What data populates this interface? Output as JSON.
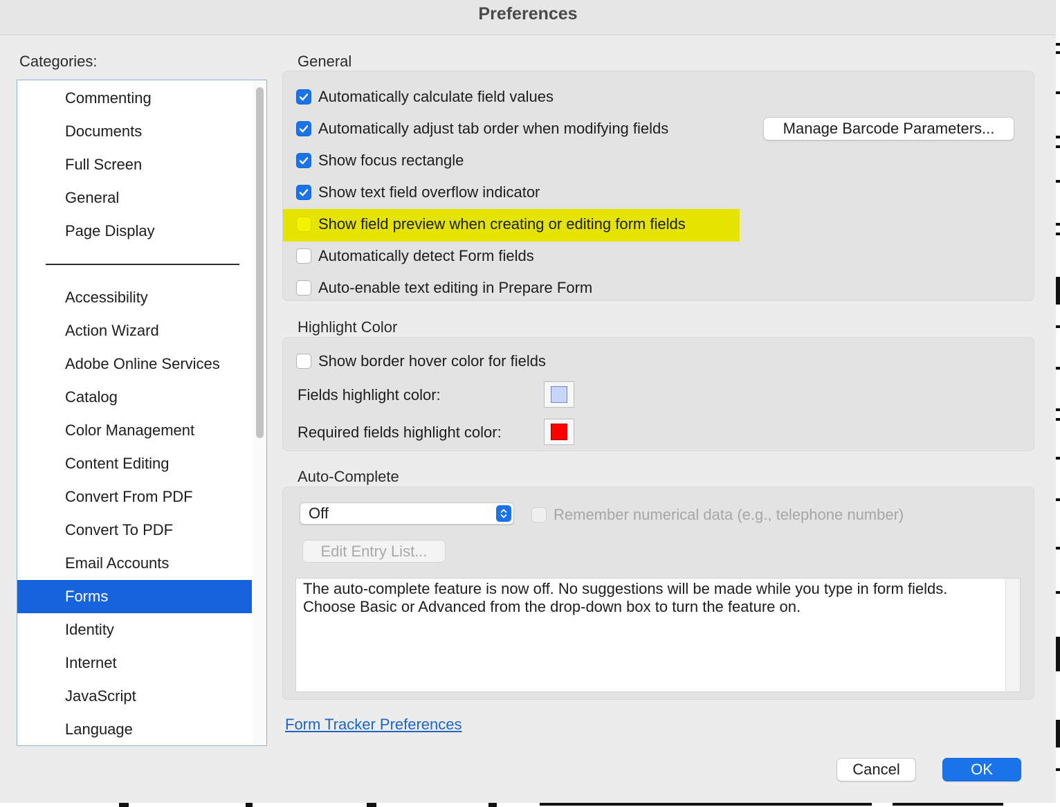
{
  "window": {
    "title": "Preferences"
  },
  "sidebar": {
    "label": "Categories:",
    "items": [
      {
        "label": "Commenting"
      },
      {
        "label": "Documents"
      },
      {
        "label": "Full Screen"
      },
      {
        "label": "General"
      },
      {
        "label": "Page Display"
      },
      {
        "label": "Accessibility"
      },
      {
        "label": "Action Wizard"
      },
      {
        "label": "Adobe Online Services"
      },
      {
        "label": "Catalog"
      },
      {
        "label": "Color Management"
      },
      {
        "label": "Content Editing"
      },
      {
        "label": "Convert From PDF"
      },
      {
        "label": "Convert To PDF"
      },
      {
        "label": "Email Accounts"
      },
      {
        "label": "Forms",
        "selected": true
      },
      {
        "label": "Identity"
      },
      {
        "label": "Internet"
      },
      {
        "label": "JavaScript"
      },
      {
        "label": "Language"
      }
    ]
  },
  "general": {
    "heading": "General",
    "options": [
      {
        "label": "Automatically calculate field values",
        "checked": true
      },
      {
        "label": "Automatically adjust tab order when modifying fields",
        "checked": true
      },
      {
        "label": "Show focus rectangle",
        "checked": true
      },
      {
        "label": "Show text field overflow indicator",
        "checked": true
      },
      {
        "label": "Show field preview when creating or editing form fields",
        "checked": false,
        "highlighted": true
      },
      {
        "label": "Automatically detect Form fields",
        "checked": false
      },
      {
        "label": "Auto-enable text editing in Prepare Form",
        "checked": false
      }
    ],
    "barcode_button": "Manage Barcode Parameters..."
  },
  "highlight": {
    "heading": "Highlight Color",
    "hover_option": {
      "label": "Show border hover color for fields",
      "checked": false
    },
    "fields_label": "Fields highlight color:",
    "fields_color": "#c9d6f7",
    "required_label": "Required fields highlight color:",
    "required_color": "#ff0000"
  },
  "autocomplete": {
    "heading": "Auto-Complete",
    "select_value": "Off",
    "remember_option": {
      "label": "Remember numerical data (e.g., telephone number)",
      "checked": false,
      "disabled": true
    },
    "edit_button": "Edit Entry List...",
    "description_line1": "The auto-complete feature is now off. No suggestions will be made while you type in form fields.",
    "description_line2": "Choose Basic or Advanced from the drop-down box to turn the feature on."
  },
  "footer": {
    "link": "Form Tracker Preferences",
    "cancel": "Cancel",
    "ok": "OK"
  },
  "colors": {
    "accent": "#1a73e8",
    "selection": "#1763de",
    "highlight_marker": "#e4e400",
    "link": "#1e64c8"
  }
}
